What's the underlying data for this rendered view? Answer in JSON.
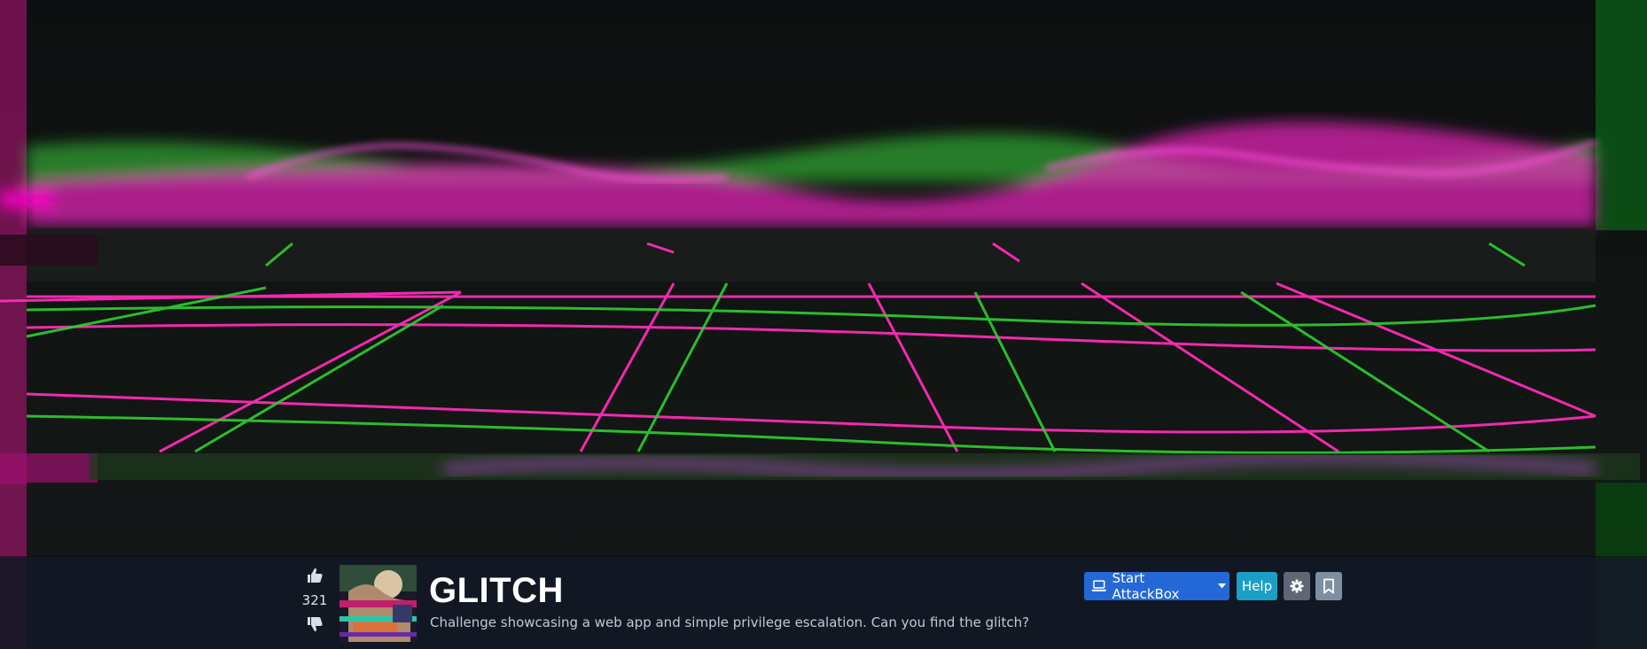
{
  "room": {
    "title": "GLITCH",
    "description": "Challenge showcasing a web app and simple privilege escalation. Can you find the glitch?",
    "votes": "321"
  },
  "actions": {
    "attackbox_label": "Start AttackBox",
    "help_label": "Help"
  },
  "icons": {
    "upvote": "thumbs-up-icon",
    "downvote": "thumbs-down-icon",
    "attackbox": "laptop-icon",
    "dropdown": "caret-down-icon",
    "settings": "gear-icon",
    "save": "bookmark-icon"
  },
  "colors": {
    "attackbox_button": "#2468d8",
    "help_button": "#1b9fc6",
    "settings_button": "#5d6776",
    "save_button": "#7f8fa2",
    "banner_magenta": "#ff2bd6",
    "banner_green": "#3bdc3b",
    "info_bar": "#121826"
  }
}
